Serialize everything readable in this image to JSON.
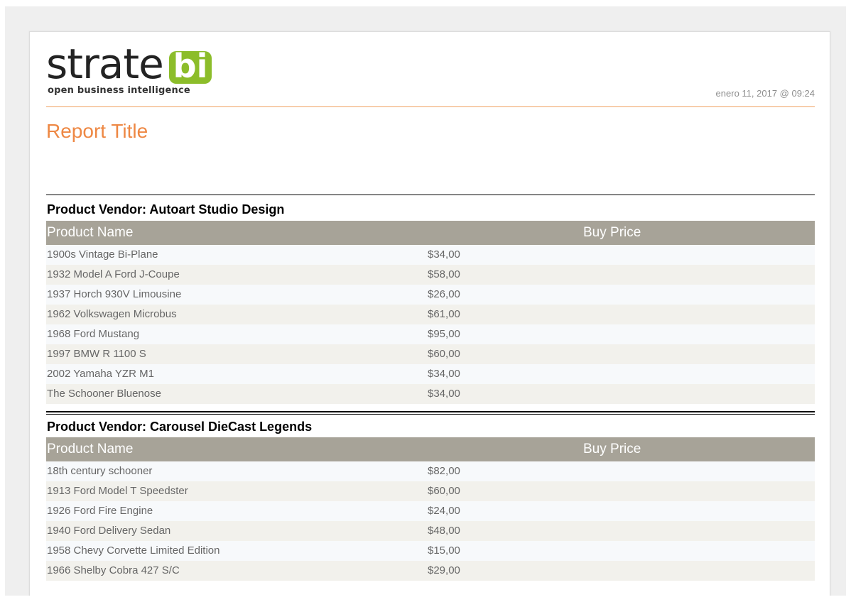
{
  "logo": {
    "word": "strate",
    "box": "bi",
    "tagline": "open business intelligence"
  },
  "report": {
    "date": "enero 11, 2017 @ 09:24",
    "title": "Report Title"
  },
  "columns": {
    "name": "Product Name",
    "price": "Buy Price"
  },
  "groups": [
    {
      "header": "Product Vendor: Autoart Studio Design",
      "rows": [
        {
          "name": "1900s Vintage Bi-Plane",
          "price": "$34,00"
        },
        {
          "name": "1932 Model A Ford J-Coupe",
          "price": "$58,00"
        },
        {
          "name": "1937 Horch 930V Limousine",
          "price": "$26,00"
        },
        {
          "name": "1962 Volkswagen Microbus",
          "price": "$61,00"
        },
        {
          "name": "1968 Ford Mustang",
          "price": "$95,00"
        },
        {
          "name": "1997 BMW R 1100 S",
          "price": "$60,00"
        },
        {
          "name": "2002 Yamaha YZR M1",
          "price": "$34,00"
        },
        {
          "name": "The Schooner Bluenose",
          "price": "$34,00"
        }
      ]
    },
    {
      "header": "Product Vendor: Carousel DieCast Legends",
      "rows": [
        {
          "name": "18th century schooner",
          "price": "$82,00"
        },
        {
          "name": "1913 Ford Model T Speedster",
          "price": "$60,00"
        },
        {
          "name": "1926 Ford Fire Engine",
          "price": "$24,00"
        },
        {
          "name": "1940 Ford Delivery Sedan",
          "price": "$48,00"
        },
        {
          "name": "1958 Chevy Corvette Limited Edition",
          "price": "$15,00"
        },
        {
          "name": "1966 Shelby Cobra 427 S/C",
          "price": "$29,00"
        }
      ]
    }
  ],
  "colors": {
    "accent": "#ee8844",
    "logo_green": "#8cbd2a",
    "header_bg": "#a7a398"
  }
}
